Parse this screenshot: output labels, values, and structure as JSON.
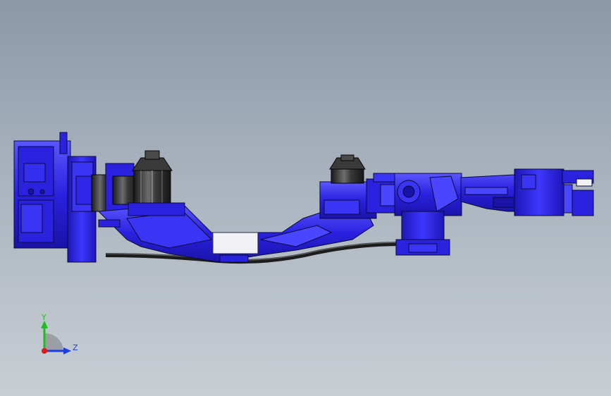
{
  "viewport": {
    "background_top": "#8a98a8",
    "background_bottom": "#c9ced4"
  },
  "model": {
    "primary_color": "#2b22e0",
    "highlight_color": "#5d5bff",
    "edge_color": "#0a0a3a",
    "motor_color": "#2e2e2e",
    "cable_color": "#1c1c1c",
    "plate_color": "#f2f2f6"
  },
  "triad": {
    "y_label": "Y",
    "z_label": "Z",
    "y_color": "#19c219",
    "z_color": "#1a3fe0",
    "origin_color": "#e01818"
  }
}
